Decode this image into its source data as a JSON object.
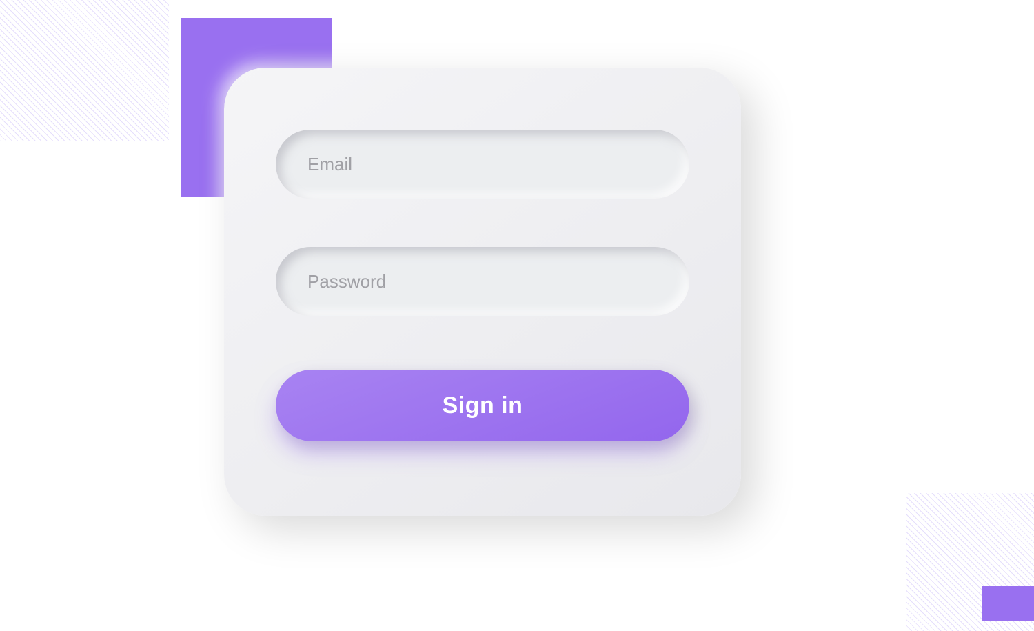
{
  "decor": {
    "accent_color": "#9970f0"
  },
  "form": {
    "email": {
      "placeholder": "Email",
      "value": ""
    },
    "password": {
      "placeholder": "Password",
      "value": ""
    },
    "submit_label": "Sign in"
  }
}
